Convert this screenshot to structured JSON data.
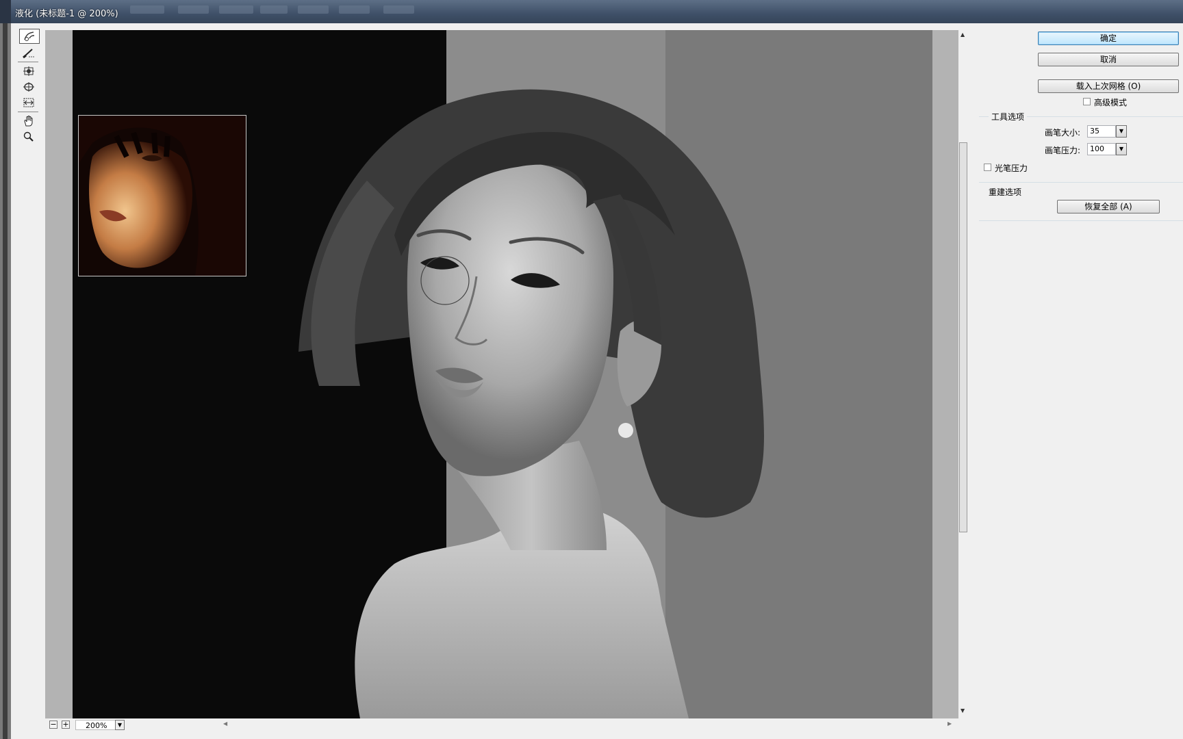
{
  "window": {
    "title": "液化 (未标题-1 @ 200%)"
  },
  "buttons": {
    "ok": "确定",
    "cancel": "取消",
    "load_mesh": "载入上次网格 (O)",
    "restore_all": "恢复全部 (A)"
  },
  "advanced_mode": {
    "label": "高级模式",
    "checked": false
  },
  "tool_options": {
    "header": "工具选项",
    "brush_size_label": "画笔大小:",
    "brush_size_value": "35",
    "brush_pressure_label": "画笔压力:",
    "brush_pressure_value": "100",
    "stylus_pressure_label": "光笔压力",
    "stylus_pressure_checked": false
  },
  "reconstruct_options": {
    "header": "重建选项"
  },
  "zoom": {
    "value": "200%"
  },
  "icons": {
    "tools": [
      "forward-warp-icon",
      "reconstruct-icon",
      "pucker-icon",
      "bloat-icon",
      "push-left-icon",
      "hand-icon",
      "zoom-icon"
    ]
  },
  "colors": {
    "accent": "#3c7fb1",
    "canvas_left": "#0a0a0a",
    "canvas_mid": "#8c8c8c",
    "canvas_right": "#7a7a7a"
  }
}
